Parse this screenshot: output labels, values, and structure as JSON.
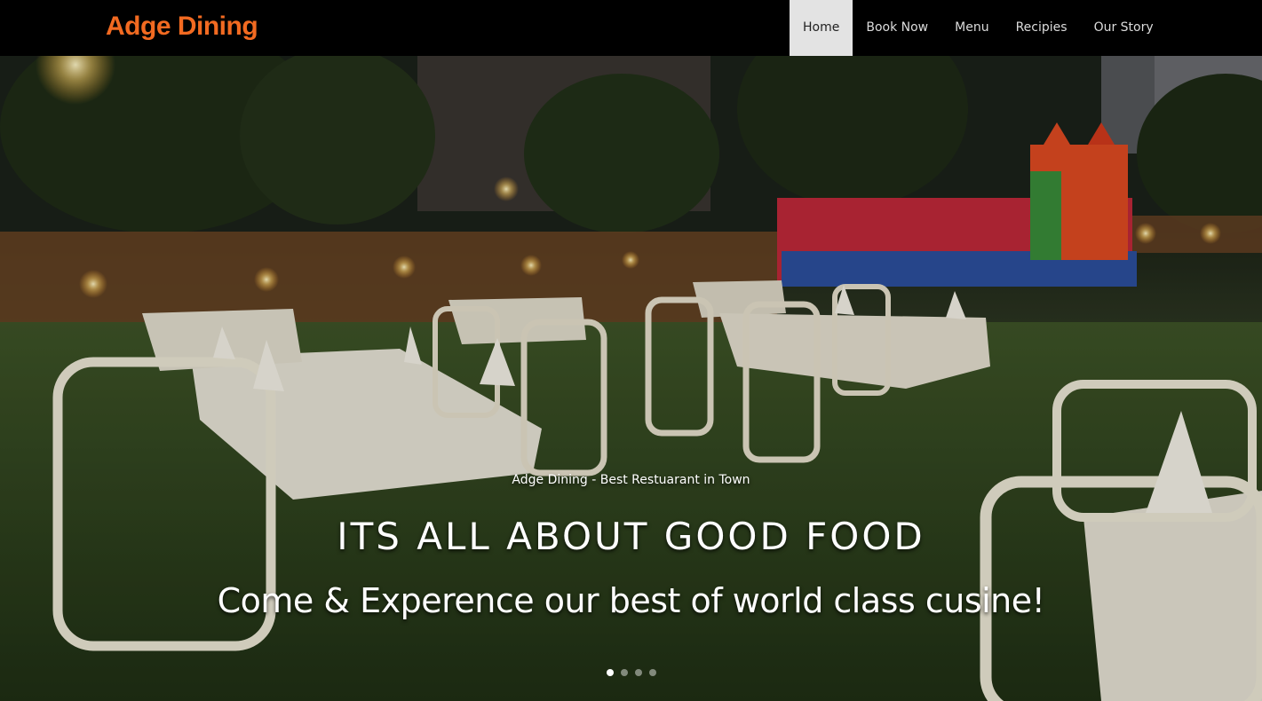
{
  "brand": {
    "name": "Adge Dining",
    "color": "#f26a21"
  },
  "nav": {
    "items": [
      {
        "label": "Home",
        "active": true
      },
      {
        "label": "Book Now",
        "active": false
      },
      {
        "label": "Menu",
        "active": false
      },
      {
        "label": "Recipies",
        "active": false
      },
      {
        "label": "Our Story",
        "active": false
      }
    ]
  },
  "hero": {
    "image_alt": "outdoor-garden-dining-photo",
    "kicker": "Adge Dining - Best Restuarant in Town",
    "headline": "ITS ALL ABOUT GOOD FOOD",
    "subheadline": "Come & Experence our best of world class cusine!",
    "slides_total": 4,
    "active_slide": 1
  }
}
